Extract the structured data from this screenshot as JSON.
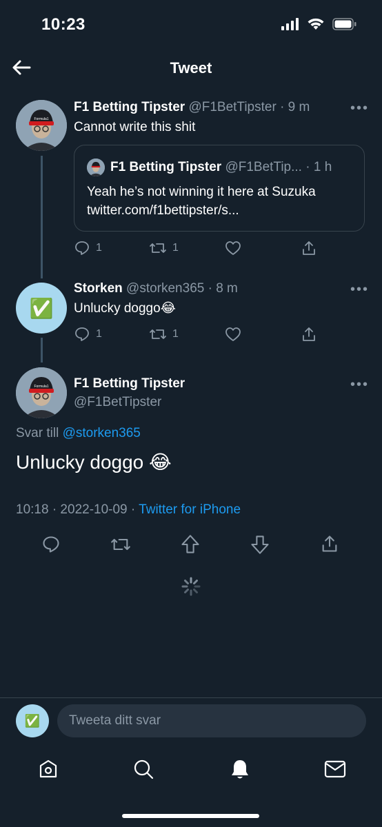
{
  "status_bar": {
    "time": "10:23"
  },
  "header": {
    "title": "Tweet"
  },
  "tweets": [
    {
      "display_name": "F1 Betting Tipster",
      "handle": "@F1BetTipster",
      "time": "· 9 m",
      "text": "Cannot write this shit",
      "quote": {
        "display_name": "F1 Betting Tipster",
        "handle": "@F1BetTip...",
        "time": "· 1 h",
        "text_line1": "Yeah he’s not winning it here at Suzuka",
        "text_line2": "twitter.com/f1bettipster/s..."
      },
      "reply_count": "1",
      "retweet_count": "1"
    },
    {
      "display_name": "Storken",
      "handle": "@storken365",
      "time": "· 8 m",
      "text": "Unlucky doggo😂",
      "reply_count": "1",
      "retweet_count": "1"
    }
  ],
  "main_tweet": {
    "display_name": "F1 Betting Tipster",
    "handle": "@F1BetTipster",
    "reply_prefix": "Svar till",
    "reply_to": "@storken365",
    "text": "Unlucky doggo 😂",
    "timestamp": "10:18 · 2022-10-09 ·",
    "source": "Twitter for iPhone"
  },
  "avatar_labels": {
    "formula": "Formula1"
  },
  "emoji": {
    "check": "✅"
  },
  "more": "•••",
  "reply_box": {
    "placeholder": "Tweeta ditt svar"
  },
  "colors": {
    "background": "#15202b",
    "accent": "#1d9bf0",
    "muted": "#8b98a5",
    "border": "#38444d"
  }
}
